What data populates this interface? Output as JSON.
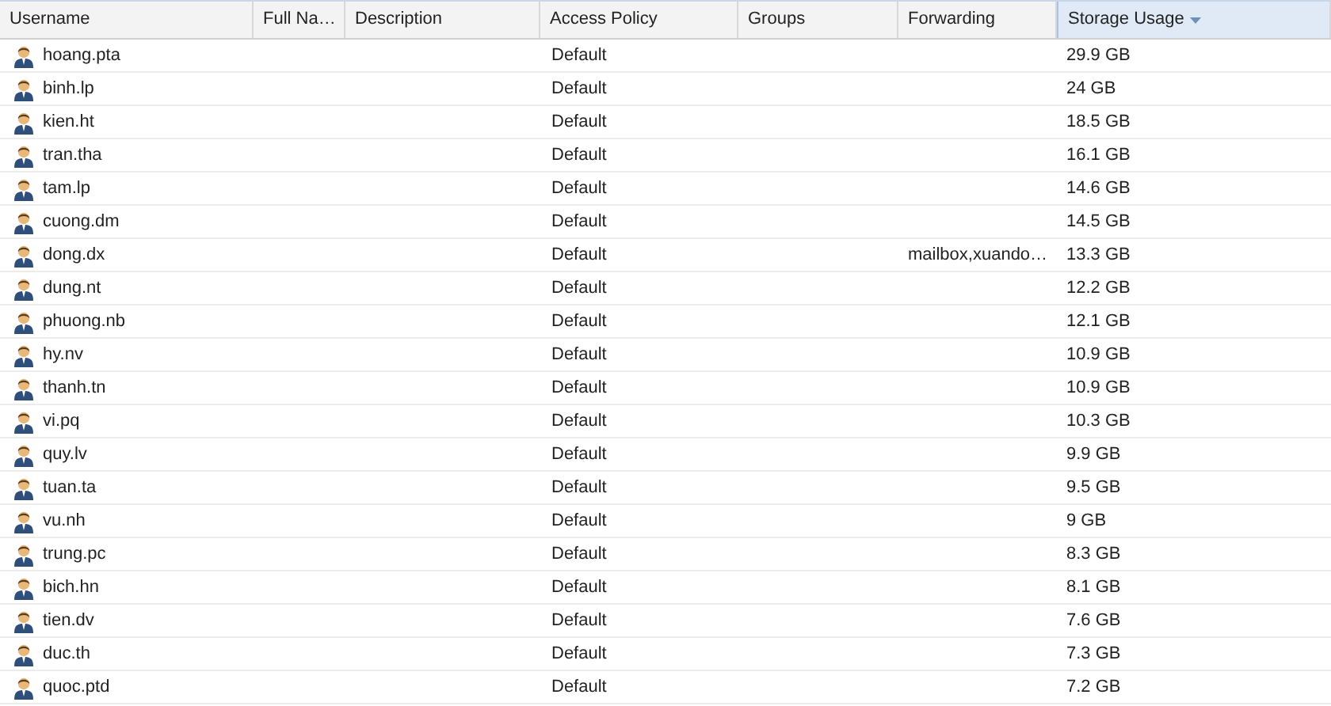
{
  "table": {
    "columns": [
      {
        "label": "Username",
        "sorted": false
      },
      {
        "label": "Full Na…",
        "sorted": false
      },
      {
        "label": "Description",
        "sorted": false
      },
      {
        "label": "Access Policy",
        "sorted": false
      },
      {
        "label": "Groups",
        "sorted": false
      },
      {
        "label": "Forwarding",
        "sorted": false
      },
      {
        "label": "Storage Usage",
        "sorted": true
      }
    ],
    "rows": [
      {
        "username": "hoang.pta",
        "access_policy": "Default",
        "storage": "29.9 GB"
      },
      {
        "username": "binh.lp",
        "access_policy": "Default",
        "storage": "24 GB"
      },
      {
        "username": "kien.ht",
        "access_policy": "Default",
        "storage": "18.5 GB"
      },
      {
        "username": "tran.tha",
        "access_policy": "Default",
        "storage": "16.1 GB"
      },
      {
        "username": "tam.lp",
        "access_policy": "Default",
        "storage": "14.6 GB"
      },
      {
        "username": "cuong.dm",
        "access_policy": "Default",
        "storage": "14.5 GB"
      },
      {
        "username": "dong.dx",
        "access_policy": "Default",
        "forwarding": "mailbox,xuando…",
        "storage": "13.3 GB"
      },
      {
        "username": "dung.nt",
        "access_policy": "Default",
        "storage": "12.2 GB"
      },
      {
        "username": "phuong.nb",
        "access_policy": "Default",
        "storage": "12.1 GB"
      },
      {
        "username": "hy.nv",
        "access_policy": "Default",
        "storage": "10.9 GB"
      },
      {
        "username": "thanh.tn",
        "access_policy": "Default",
        "storage": "10.9 GB"
      },
      {
        "username": "vi.pq",
        "access_policy": "Default",
        "storage": "10.3 GB"
      },
      {
        "username": "quy.lv",
        "access_policy": "Default",
        "storage": "9.9 GB"
      },
      {
        "username": "tuan.ta",
        "access_policy": "Default",
        "storage": "9.5 GB"
      },
      {
        "username": "vu.nh",
        "access_policy": "Default",
        "storage": "9 GB"
      },
      {
        "username": "trung.pc",
        "access_policy": "Default",
        "storage": "8.3 GB"
      },
      {
        "username": "bich.hn",
        "access_policy": "Default",
        "storage": "8.1 GB"
      },
      {
        "username": "tien.dv",
        "access_policy": "Default",
        "storage": "7.6 GB"
      },
      {
        "username": "duc.th",
        "access_policy": "Default",
        "storage": "7.3 GB"
      },
      {
        "username": "quoc.ptd",
        "access_policy": "Default",
        "storage": "7.2 GB"
      }
    ]
  }
}
